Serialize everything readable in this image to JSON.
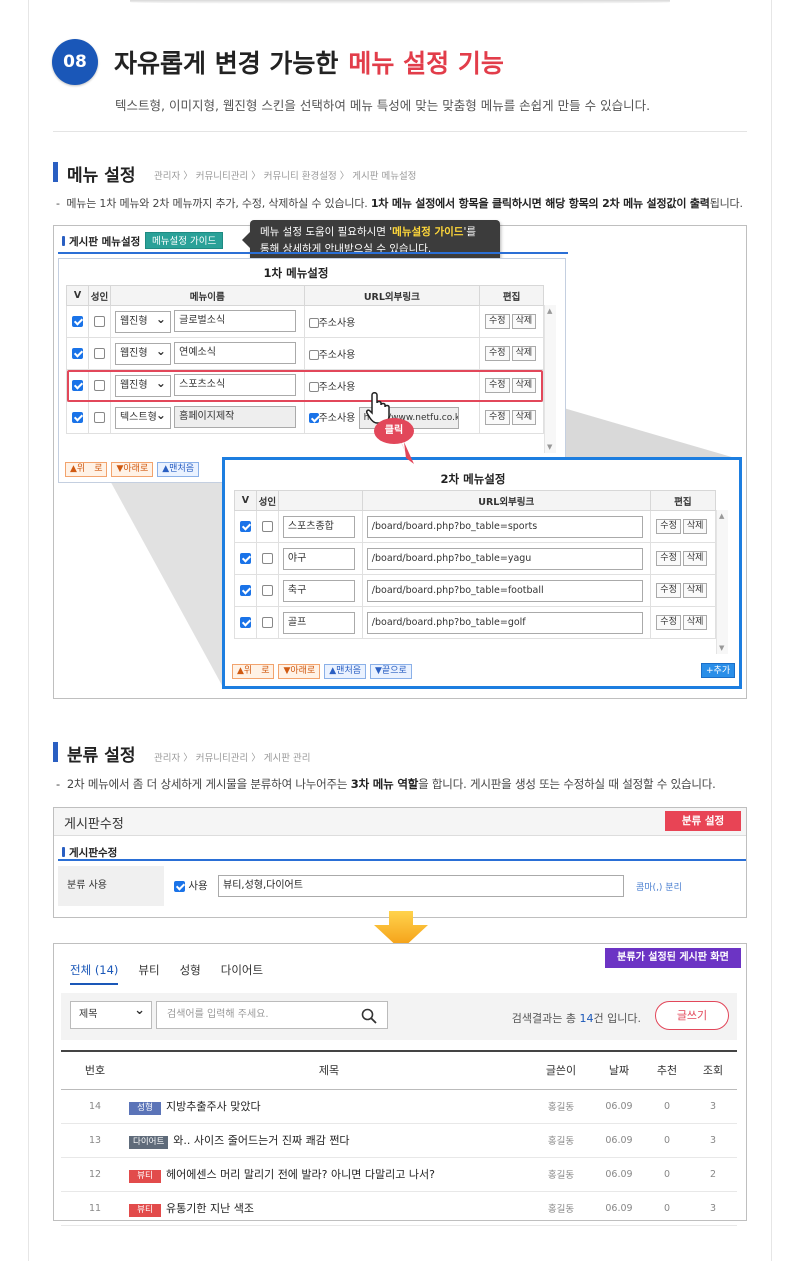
{
  "header": {
    "number": "08",
    "title": "자유롭게 변경 가능한",
    "title_highlight": "메뉴 설정 기능",
    "subtitle": "텍스트형, 이미지형, 웹진형 스킨을 선택하여 메뉴 특성에 맞는 맞춤형 메뉴를 손쉽게 만들 수 있습니다."
  },
  "menu_section": {
    "title": "메뉴 설정",
    "breadcrumb": "관리자 〉 커뮤니티관리 〉 커뮤니티 환경설정 〉 게시판 메뉴설정",
    "desc_plain": "메뉴는 1차 메뉴와 2차 메뉴까지 추가, 수정, 삭제하실 수 있습니다.",
    "desc_bold1": "1차 메뉴 설정에서 항목을 클릭하시면 해당 항목의 2차 메뉴 설정값이 출력",
    "desc_end": "됩니다.",
    "panel_title": "게시판 메뉴설정",
    "guide_button": "메뉴설정 가이드",
    "tooltip_line1_a": "메뉴 설정 도움이 필요하시면 '",
    "tooltip_line1_h": "메뉴설정 가이드",
    "tooltip_line1_b": "'를",
    "tooltip_line2": "통해 상세하게 안내받으실 수 있습니다.",
    "primary_title": "1차 메뉴설정",
    "primary_headers": [
      "V",
      "성인",
      "메뉴이름",
      "URL외부링크",
      "편집"
    ],
    "primary_rows": [
      {
        "skin": "웹진형",
        "name": "글로벌소식",
        "ext": "주소사용",
        "url": ""
      },
      {
        "skin": "웹진형",
        "name": "연예소식",
        "ext": "주소사용",
        "url": ""
      },
      {
        "skin": "웹진형",
        "name": "스포츠소식",
        "ext": "주소사용",
        "url": ""
      },
      {
        "skin": "텍스트형",
        "name": "홈페이지제작",
        "ext": "주소사용",
        "url": "http://www.netfu.co.kr"
      }
    ],
    "edit_label": "수정",
    "delete_label": "삭제",
    "order_buttons": [
      "▲위　로",
      "▼아래로",
      "▲맨처음",
      "▼끝으로"
    ],
    "click_label": "클릭",
    "secondary_title": "2차 메뉴설정",
    "secondary_headers": [
      "V",
      "성인",
      "",
      "URL외부링크",
      "편집"
    ],
    "secondary_rows": [
      {
        "name": "스포츠종합",
        "url": "/board/board.php?bo_table=sports"
      },
      {
        "name": "야구",
        "url": "/board/board.php?bo_table=yagu"
      },
      {
        "name": "축구",
        "url": "/board/board.php?bo_table=football"
      },
      {
        "name": "골프",
        "url": "/board/board.php?bo_table=golf"
      }
    ],
    "add_label": "+추가"
  },
  "category_section": {
    "title": "분류 설정",
    "breadcrumb": "관리자 〉 커뮤니티관리 〉 게시판 관리",
    "desc_plain": "2차 메뉴에서 좀 더 상세하게 게시물을 분류하여 나누어주는",
    "desc_bold": "3차 메뉴 역할",
    "desc_end": "을 합니다. 게시판을 생성 또는 수정하실 때 설정할 수 있습니다.",
    "edit_box_title": "게시판수정",
    "red_label": "분류 설정",
    "sub_title": "게시판수정",
    "row_label": "분류 사용",
    "use_label": "사용",
    "categories_value": "뷰티,성형,다이어트",
    "separator_hint": "콤마(,) 분리"
  },
  "board": {
    "purple_label": "분류가 설정된 게시판 화면",
    "tabs": [
      "전체 (14)",
      "뷰티",
      "성형",
      "다이어트"
    ],
    "search_select": "제목",
    "search_placeholder": "검색어를 입력해 주세요.",
    "result_prefix": "검색결과는 총 ",
    "result_count": "14",
    "result_suffix": "건 입니다.",
    "write_button": "글쓰기",
    "headers": [
      "번호",
      "제목",
      "글쓴이",
      "날짜",
      "추천",
      "조회"
    ],
    "rows": [
      {
        "no": "14",
        "cat": "성형",
        "title": "지방추출주사 맞았다",
        "author": "홍길동",
        "date": "06.09",
        "rec": "0",
        "views": "3"
      },
      {
        "no": "13",
        "cat": "다이어트",
        "title": "와.. 사이즈 줄어드는거 진짜 쾌감 쩐다",
        "author": "홍길동",
        "date": "06.09",
        "rec": "0",
        "views": "3"
      },
      {
        "no": "12",
        "cat": "뷰티",
        "title": "헤어에센스 머리 말리기 전에 발라? 아니면 다말리고 나서?",
        "author": "홍길동",
        "date": "06.09",
        "rec": "0",
        "views": "2"
      },
      {
        "no": "11",
        "cat": "뷰티",
        "title": "유통기한 지난 색조",
        "author": "홍길동",
        "date": "06.09",
        "rec": "0",
        "views": "3"
      }
    ],
    "cat_colors": {
      "성형": "#5b74b8",
      "다이어트": "#5f6b7a",
      "뷰티": "#e24b4b"
    }
  }
}
